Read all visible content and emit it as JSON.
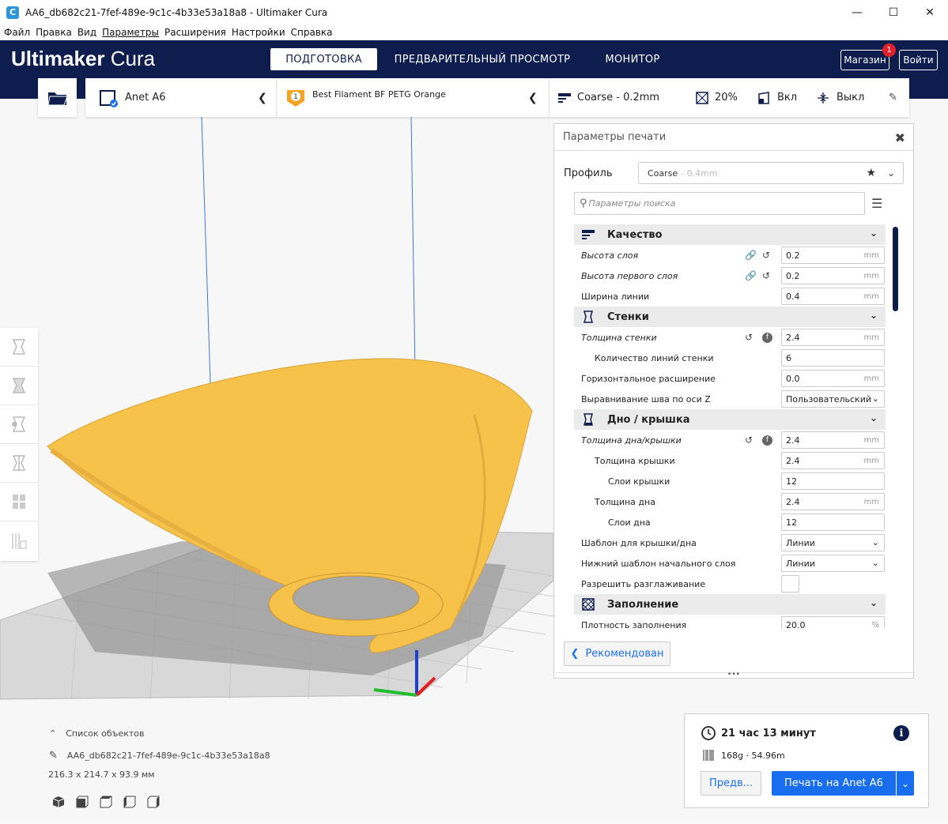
{
  "window": {
    "title": "AA6_db682c21-7fef-489e-9c1c-4b33e53a18a8 - Ultimaker Cura",
    "app_icon": "C"
  },
  "menu": [
    "Файл",
    "Правка",
    "Вид",
    "Параметры",
    "Расширения",
    "Настройки",
    "Справка"
  ],
  "header": {
    "logo_bold": "Ultimaker",
    "logo_light": "Cura",
    "stages": [
      "ПОДГОТОВКА",
      "ПРЕДВАРИТЕЛЬНЫЙ ПРОСМОТР",
      "МОНИТОР"
    ],
    "marketplace": "Магазин",
    "marketplace_badge": "1",
    "signin": "Войти"
  },
  "toolbar": {
    "printer": "Anet A6",
    "material": "Best Filament BF PETG Orange",
    "extruder_number": "1",
    "profile": "Coarse - 0.2mm",
    "infill": "20%",
    "support": "Вкл",
    "adhesion": "Выкл"
  },
  "panel": {
    "title": "Параметры печати",
    "profile_label": "Профиль",
    "profile_value": "Coarse",
    "profile_dim": "- 0.4mm",
    "search_placeholder": "Параметры поиска",
    "sections": [
      {
        "title": "Качество",
        "rows": [
          {
            "name": "Высота слоя",
            "italic": true,
            "indent": 0,
            "value": "0.2",
            "unit": "mm",
            "link": true,
            "reset": true
          },
          {
            "name": "Высота первого слоя",
            "italic": true,
            "indent": 0,
            "value": "0.2",
            "unit": "mm",
            "link": true,
            "reset": true
          },
          {
            "name": "Ширина линии",
            "italic": false,
            "indent": 0,
            "value": "0.4",
            "unit": "mm"
          }
        ]
      },
      {
        "title": "Стенки",
        "rows": [
          {
            "name": "Толщина стенки",
            "italic": true,
            "indent": 0,
            "value": "2.4",
            "unit": "mm",
            "reset": true,
            "func": true
          },
          {
            "name": "Количество линий стенки",
            "italic": false,
            "indent": 1,
            "value": "6",
            "unit": ""
          },
          {
            "name": "Горизонтальное расширение",
            "italic": false,
            "indent": 0,
            "value": "0.0",
            "unit": "mm"
          },
          {
            "name": "Выравнивание шва по оси Z",
            "italic": false,
            "indent": 0,
            "value": "Пользовательский",
            "unit": "",
            "dropdown": true
          }
        ]
      },
      {
        "title": "Дно / крышка",
        "rows": [
          {
            "name": "Толщина дна/крышки",
            "italic": true,
            "indent": 0,
            "value": "2.4",
            "unit": "mm",
            "reset": true,
            "func": true
          },
          {
            "name": "Толщина крышки",
            "italic": false,
            "indent": 1,
            "value": "2.4",
            "unit": "mm"
          },
          {
            "name": "Слои крышки",
            "italic": false,
            "indent": 2,
            "value": "12",
            "unit": ""
          },
          {
            "name": "Толщина дна",
            "italic": false,
            "indent": 1,
            "value": "2.4",
            "unit": "mm"
          },
          {
            "name": "Слои дна",
            "italic": false,
            "indent": 2,
            "value": "12",
            "unit": ""
          },
          {
            "name": "Шаблон для крышки/дна",
            "italic": false,
            "indent": 0,
            "value": "Линии",
            "unit": "",
            "dropdown": true
          },
          {
            "name": "Нижний шаблон начального слоя",
            "italic": false,
            "indent": 0,
            "value": "Линии",
            "unit": "",
            "dropdown": true
          },
          {
            "name": "Разрешить разглаживание",
            "italic": false,
            "indent": 0,
            "checkbox": true
          }
        ]
      },
      {
        "title": "Заполнение",
        "rows": [
          {
            "name": "Плотность заполнения",
            "italic": false,
            "indent": 0,
            "value": "20.0",
            "unit": "%"
          }
        ]
      }
    ],
    "recommended_button": "Рекомендован"
  },
  "objects": {
    "header": "Список объектов",
    "name": "AA6_db682c21-7fef-489e-9c1c-4b33e53a18a8",
    "dimensions": "216.3 x 214.7 x 93.9 мм"
  },
  "action": {
    "time": "21 час 13 минут",
    "material": "168g · 54.96m",
    "preview_button": "Предв...",
    "print_button": "Печать на Anet A6"
  },
  "colors": {
    "header": "#0d1d4d",
    "accent": "#196ef0",
    "model": "#f7c24a"
  }
}
